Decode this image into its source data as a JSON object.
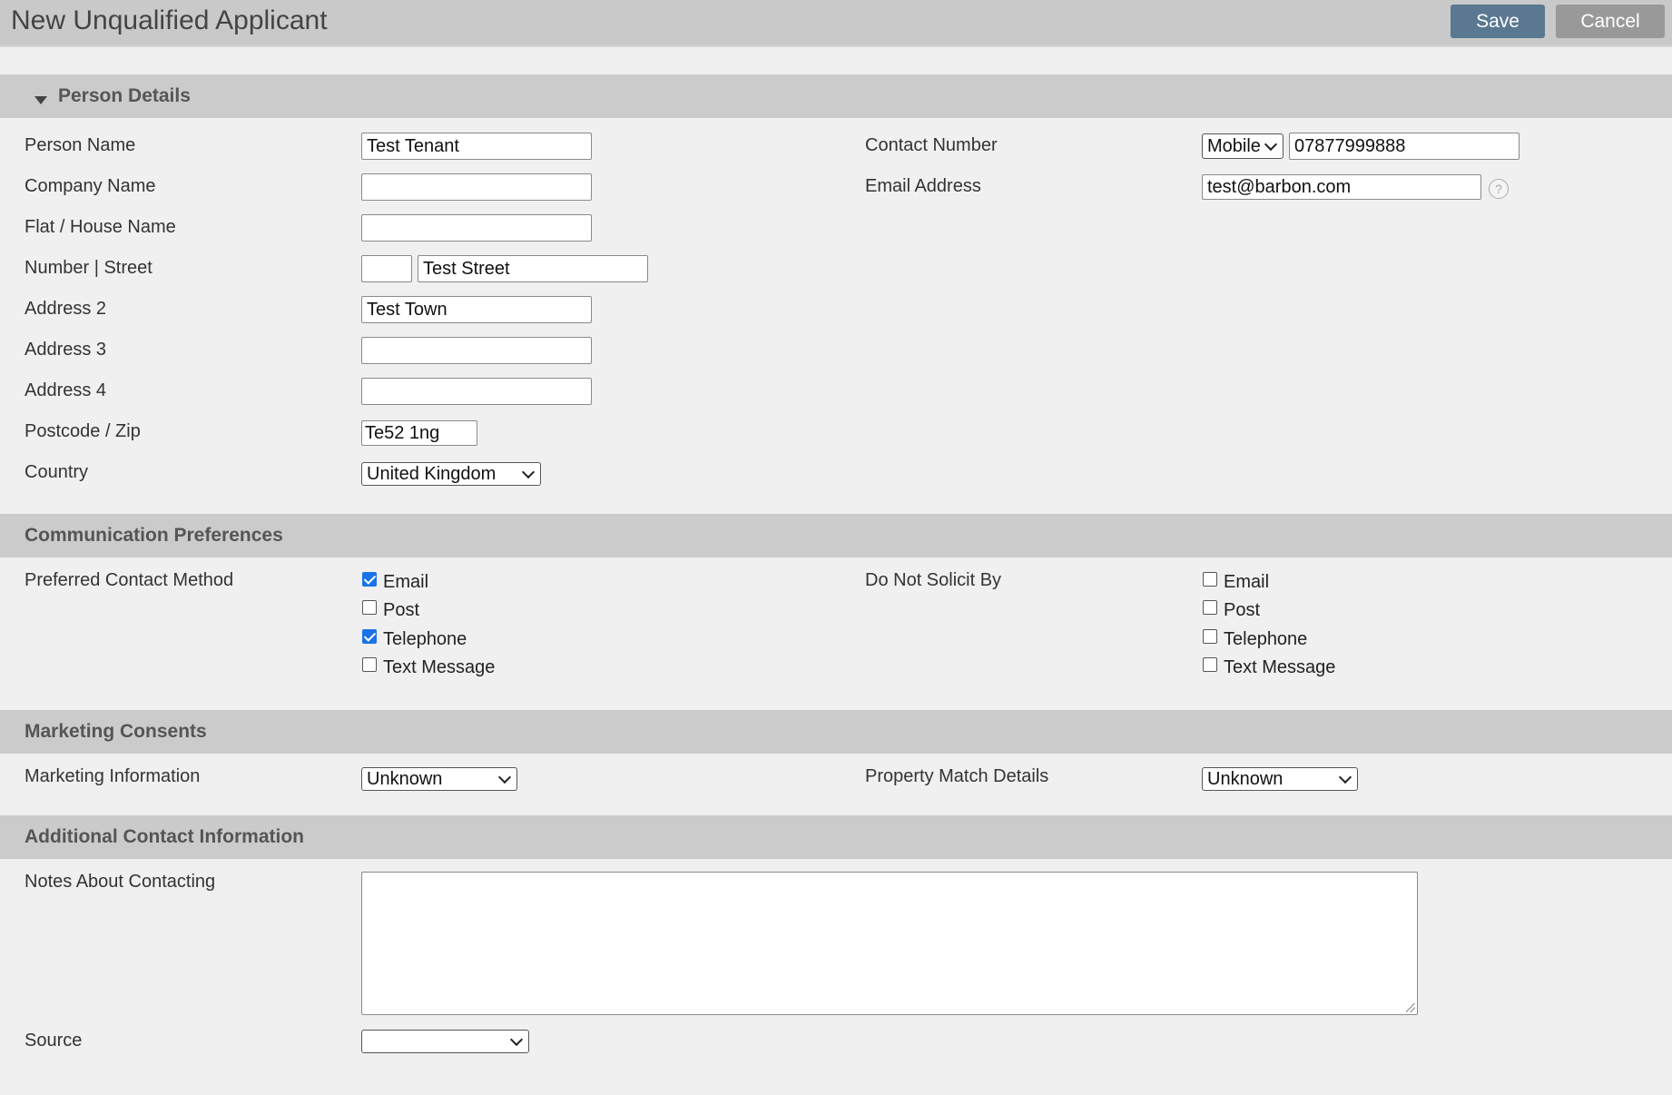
{
  "header": {
    "title": "New Unqualified Applicant",
    "save_label": "Save",
    "cancel_label": "Cancel"
  },
  "person_details": {
    "section_title": "Person Details",
    "person_name": {
      "label": "Person Name",
      "value": "Test Tenant"
    },
    "company_name": {
      "label": "Company Name",
      "value": ""
    },
    "flat_house_name": {
      "label": "Flat / House Name",
      "value": ""
    },
    "number_street": {
      "label": "Number | Street",
      "number": "",
      "street": "Test Street"
    },
    "address2": {
      "label": "Address 2",
      "value": "Test Town"
    },
    "address3": {
      "label": "Address 3",
      "value": ""
    },
    "address4": {
      "label": "Address 4",
      "value": ""
    },
    "postcode": {
      "label": "Postcode / Zip",
      "value": "Te52 1ng"
    },
    "country": {
      "label": "Country",
      "value": "United Kingdom"
    },
    "contact_number": {
      "label": "Contact Number",
      "type": "Mobile",
      "value": "07877999888"
    },
    "email": {
      "label": "Email Address",
      "value": "test@barbon.com",
      "help": "?"
    }
  },
  "communication": {
    "section_title": "Communication Preferences",
    "preferred_label": "Preferred Contact Method",
    "preferred_options": [
      {
        "label": "Email",
        "checked": true
      },
      {
        "label": "Post",
        "checked": false
      },
      {
        "label": "Telephone",
        "checked": true
      },
      {
        "label": "Text Message",
        "checked": false
      }
    ],
    "dns_label": "Do Not Solicit By",
    "dns_options": [
      {
        "label": "Email",
        "checked": false
      },
      {
        "label": "Post",
        "checked": false
      },
      {
        "label": "Telephone",
        "checked": false
      },
      {
        "label": "Text Message",
        "checked": false
      }
    ]
  },
  "marketing": {
    "section_title": "Marketing Consents",
    "marketing_info": {
      "label": "Marketing Information",
      "value": "Unknown"
    },
    "property_match": {
      "label": "Property Match Details",
      "value": "Unknown"
    }
  },
  "additional": {
    "section_title": "Additional Contact Information",
    "notes_label": "Notes About Contacting",
    "notes_value": "",
    "source_label": "Source",
    "source_value": ""
  }
}
